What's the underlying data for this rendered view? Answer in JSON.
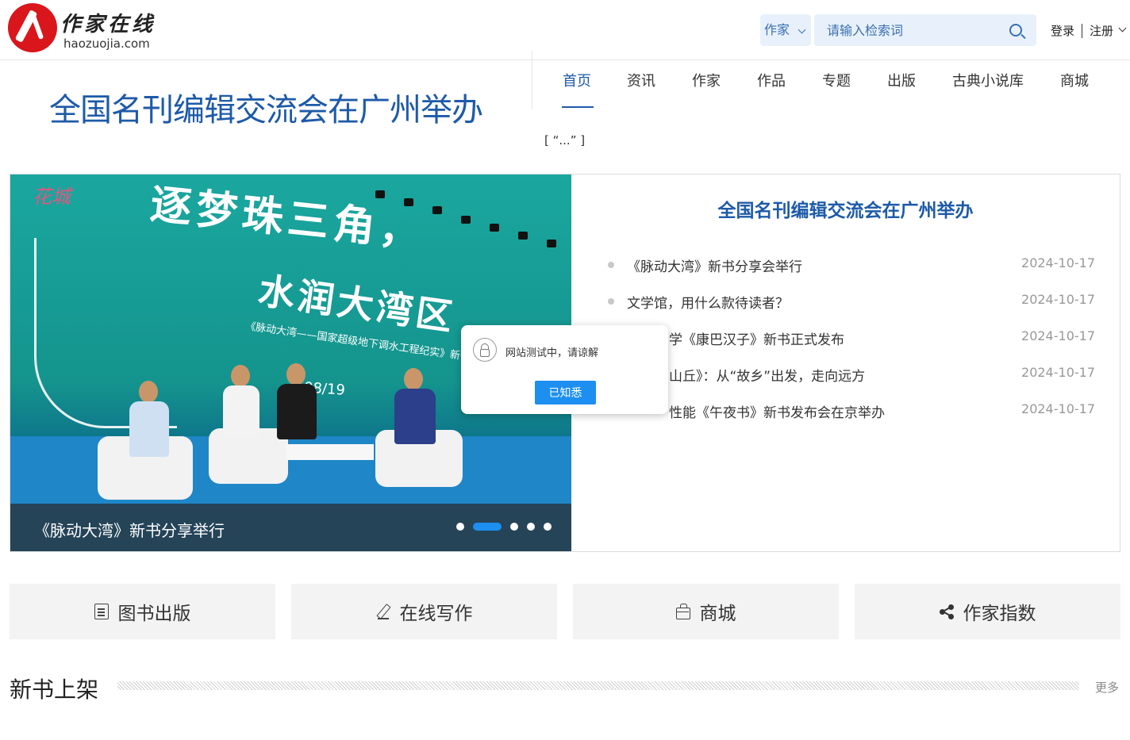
{
  "brand": {
    "cn": "作家在线",
    "en": "haozuojia.com"
  },
  "search": {
    "category": "作家",
    "placeholder": "请输入检索词"
  },
  "auth": {
    "login": "登录",
    "register": "注册"
  },
  "headline": "全国名刊编辑交流会在广州举办",
  "nav": {
    "items": [
      {
        "label": "首页",
        "active": true
      },
      {
        "label": "资讯"
      },
      {
        "label": "作家"
      },
      {
        "label": "作品"
      },
      {
        "label": "专题"
      },
      {
        "label": "出版"
      },
      {
        "label": "古典小说库"
      },
      {
        "label": "商城"
      }
    ],
    "bracket_note": "[ “...” ]"
  },
  "slider": {
    "poster_line1": "逐梦珠三角，",
    "poster_line2": "水润大湾区",
    "poster_sub": "《脉动大湾——国家超级地下调水工程纪实》新书分享会",
    "poster_brand": "花城",
    "poster_date": "08/19",
    "caption": "《脉动大湾》新书分享举行",
    "dots": 5,
    "active_dot": 2
  },
  "news": {
    "title": "全国名刊编辑交流会在广州举办",
    "items": [
      {
        "text": "《脉动大湾》新书分享会举行",
        "date": "2024-10-17"
      },
      {
        "text": "文学馆，用什么款待读者？",
        "date": "2024-10-17"
      },
      {
        "text": "学《康巴汉子》新书正式发布",
        "date": "2024-10-17"
      },
      {
        "text": "山丘》：从“故乡”出发，走向远方",
        "date": "2024-10-17"
      },
      {
        "text": "性能《午夜书》新书发布会在京举办",
        "date": "2024-10-17"
      }
    ]
  },
  "modal": {
    "message": "网站测试中，请谅解",
    "button": "已知悉"
  },
  "quick_links": [
    {
      "label": "图书出版",
      "icon": "document-icon"
    },
    {
      "label": "在线写作",
      "icon": "pen-icon"
    },
    {
      "label": "商城",
      "icon": "shopping-bag-icon"
    },
    {
      "label": "作家指数",
      "icon": "share-icon"
    }
  ],
  "section": {
    "title": "新书上架",
    "more": "更多"
  },
  "colors": {
    "brand_red": "#d9161c",
    "primary_blue": "#1e5aa8",
    "accent_blue": "#1d8ff0",
    "search_bg": "#e8f1fb"
  }
}
